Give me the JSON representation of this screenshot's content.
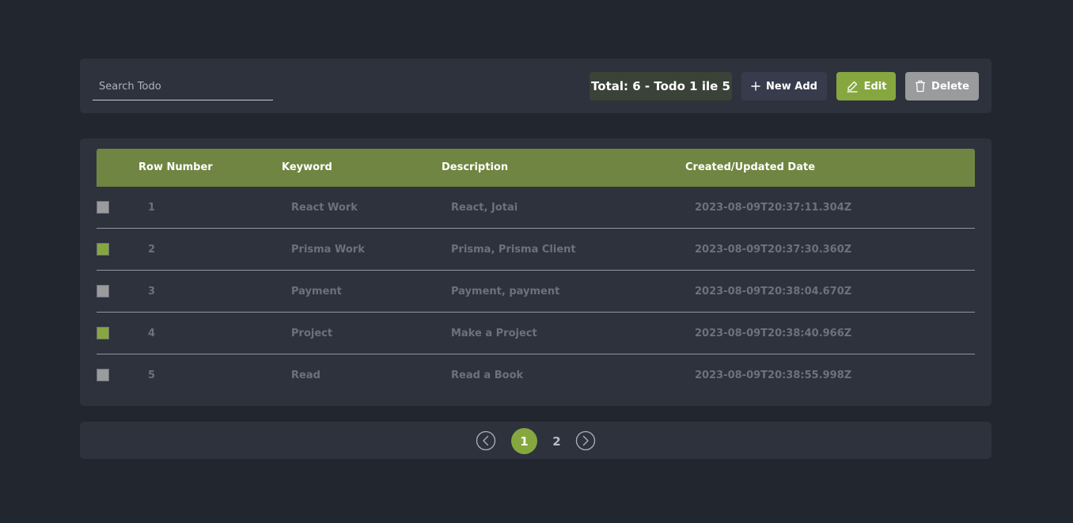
{
  "search": {
    "placeholder": "Search Todo",
    "value": ""
  },
  "toolbar": {
    "total_label": "Total: 6 - Todo 1 ile 5",
    "new_label": "New Add",
    "edit_label": "Edit",
    "delete_label": "Delete"
  },
  "table": {
    "headers": {
      "row_number": "Row Number",
      "keyword": "Keyword",
      "description": "Description",
      "date": "Created/Updated Date"
    },
    "rows": [
      {
        "num": "1",
        "keyword": "React Work",
        "description": "React, Jotai",
        "date": "2023-08-09T20:37:11.304Z",
        "checked": false
      },
      {
        "num": "2",
        "keyword": "Prisma Work",
        "description": "Prisma, Prisma Client",
        "date": "2023-08-09T20:37:30.360Z",
        "checked": true
      },
      {
        "num": "3",
        "keyword": "Payment",
        "description": "Payment, payment",
        "date": "2023-08-09T20:38:04.670Z",
        "checked": false
      },
      {
        "num": "4",
        "keyword": "Project",
        "description": "Make a Project",
        "date": "2023-08-09T20:38:40.966Z",
        "checked": true
      },
      {
        "num": "5",
        "keyword": "Read",
        "description": "Read a Book",
        "date": "2023-08-09T20:38:55.998Z",
        "checked": false
      }
    ]
  },
  "pagination": {
    "pages": [
      "1",
      "2"
    ],
    "current_page": "1"
  },
  "colors": {
    "accent": "#86a73f",
    "header": "#708541",
    "checkbox_checked": "#86a73f",
    "checkbox_unchecked": "#9a9b9d"
  },
  "icons": {
    "new": "plus-icon",
    "edit": "pencil-icon",
    "delete": "trash-icon",
    "prev": "chevron-left-circle-icon",
    "next": "chevron-right-circle-icon"
  }
}
